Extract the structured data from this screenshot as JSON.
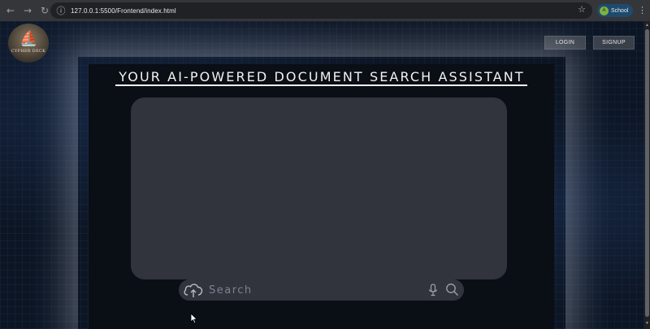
{
  "browser": {
    "url": "127.0.0.1:5500/Frontend/index.html",
    "profile_initial": "A",
    "profile_label": "School"
  },
  "brand": {
    "logo_text": "CYPHER",
    "logo_subtext": "DECK"
  },
  "header": {
    "login_label": "LOGIN",
    "signup_label": "SIGNUP"
  },
  "main": {
    "title": "YOUR AI-POWERED DOCUMENT SEARCH ASSISTANT"
  },
  "search": {
    "placeholder": "Search"
  },
  "icons": {
    "upload": "cloud-upload-icon",
    "mic": "microphone-icon",
    "search": "magnifier-icon"
  },
  "colors": {
    "panel": "#0a0e15",
    "chat_area": "#31343d",
    "search_bar": "#31343d",
    "button": "#3a404a"
  }
}
